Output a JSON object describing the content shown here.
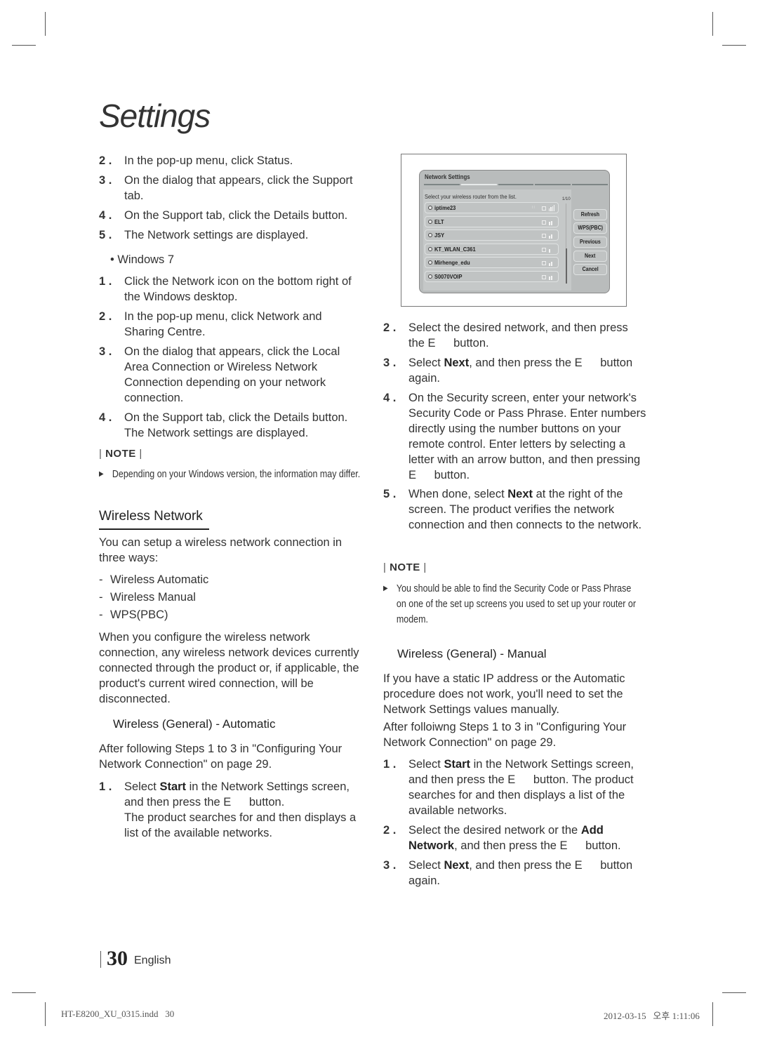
{
  "page": {
    "title": "Settings",
    "page_number": "30",
    "language": "English"
  },
  "left": {
    "intro_steps": [
      {
        "num": "2 .",
        "text": "In the pop-up menu, click Status."
      },
      {
        "num": "3 .",
        "text": "On the dialog that appears, click the Support tab."
      },
      {
        "num": "4 .",
        "text": "On the Support tab, click the Details button."
      },
      {
        "num": "5 .",
        "text": "The Network settings are displayed."
      }
    ],
    "windows7_bullet": "• Windows 7",
    "win7_steps": [
      {
        "num": "1 .",
        "text": "Click the Network icon on the bottom right of the Windows desktop."
      },
      {
        "num": "2 .",
        "text": "In the pop-up menu, click Network and Sharing Centre."
      },
      {
        "num": "3 .",
        "text": "On the dialog that appears, click the Local Area Connection or Wireless Network Connection depending on your network connection."
      },
      {
        "num": "4 .",
        "text": "On the Support tab, click the Details button. The Network settings are displayed."
      }
    ],
    "note_label": "NOTE",
    "note_text": "Depending on your Windows version, the information may differ.",
    "wireless_heading": "Wireless Network",
    "wireless_intro": "You can setup a wireless network connection in three ways:",
    "wireless_ways": [
      "Wireless Automatic",
      "Wireless Manual",
      "WPS(PBC)"
    ],
    "wireless_warning": "When you configure the wireless network connection, any wireless network devices currently connected through the product or, if applicable, the product's current wired connection, will be disconnected.",
    "auto_heading": "Wireless (General) - Automatic",
    "auto_intro": "After following Steps 1 to 3 in \"Configuring Your Network Connection\" on page 29.",
    "auto_step1": {
      "num": "1 .",
      "pre": "Select ",
      "bold": "Start",
      "mid": " in the Network Settings screen, and then press the ",
      "key": "E",
      "post": " button.",
      "extra": "The product searches for and then displays a list of the available networks."
    }
  },
  "screenshot": {
    "title": "Network Settings",
    "instruction": "Select your wireless router from the list.",
    "page_indicator": "1/10",
    "networks": [
      {
        "name": "iptime23",
        "signal": 4,
        "wps": true
      },
      {
        "name": "ELT",
        "signal": 2,
        "wps": false
      },
      {
        "name": "JSY",
        "signal": 2,
        "wps": false
      },
      {
        "name": "KT_WLAN_C361",
        "signal": 1,
        "wps": false
      },
      {
        "name": "Mirhenge_edu",
        "signal": 2,
        "wps": false
      },
      {
        "name": "S0070VOIP",
        "signal": 2,
        "wps": false
      }
    ],
    "buttons": [
      "Refresh",
      "WPS(PBC)",
      "Previous",
      "Next",
      "Cancel"
    ],
    "active_step": 2,
    "total_steps": 5
  },
  "right": {
    "steps": [
      {
        "num": "2 .",
        "segments": [
          {
            "t": "Select the desired network, and then press the "
          },
          {
            "k": "E"
          },
          {
            "t": " button."
          }
        ]
      },
      {
        "num": "3 .",
        "segments": [
          {
            "t": "Select "
          },
          {
            "b": "Next"
          },
          {
            "t": ", and then press the "
          },
          {
            "k": "E"
          },
          {
            "t": " button again."
          }
        ]
      },
      {
        "num": "4 .",
        "segments": [
          {
            "t": "On the Security screen, enter your network's Security Code or Pass Phrase. Enter numbers directly using the number buttons on your remote control. Enter letters by selecting a letter with an arrow button, and then pressing "
          },
          {
            "k": "E"
          },
          {
            "t": " button."
          }
        ]
      },
      {
        "num": "5 .",
        "segments": [
          {
            "t": "When done, select "
          },
          {
            "b": "Next"
          },
          {
            "t": " at the right of the screen. The product verifies the network connection and then connects to the network."
          }
        ]
      }
    ],
    "note_label": "NOTE",
    "note_text": "You should be able to find the Security Code or Pass Phrase on one of the set up screens you used to set up your router or modem.",
    "manual_heading": "Wireless (General) - Manual",
    "manual_intro": "If you have a static IP address or the Automatic procedure does not work, you'll need to set the Network Settings values manually.",
    "manual_intro2": "After folloiwng Steps 1 to 3 in \"Configuring Your Network Connection\" on page 29.",
    "manual_steps": [
      {
        "num": "1 .",
        "segments": [
          {
            "t": "Select "
          },
          {
            "b": "Start"
          },
          {
            "t": " in the Network Settings screen, and then press the "
          },
          {
            "k": "E"
          },
          {
            "t": " button. The product searches for and then displays a list of the available networks."
          }
        ]
      },
      {
        "num": "2 .",
        "segments": [
          {
            "t": "Select the desired network or the "
          },
          {
            "b": "Add Network"
          },
          {
            "t": ", and then press the "
          },
          {
            "k": "E"
          },
          {
            "t": " button."
          }
        ]
      },
      {
        "num": "3 .",
        "segments": [
          {
            "t": "Select "
          },
          {
            "b": "Next"
          },
          {
            "t": ", and then press the "
          },
          {
            "k": "E"
          },
          {
            "t": " button again."
          }
        ]
      }
    ]
  },
  "slug": {
    "filename": "HT-E8200_XU_0315.indd   30",
    "datetime": "2012-03-15   오후 1:11:06"
  }
}
